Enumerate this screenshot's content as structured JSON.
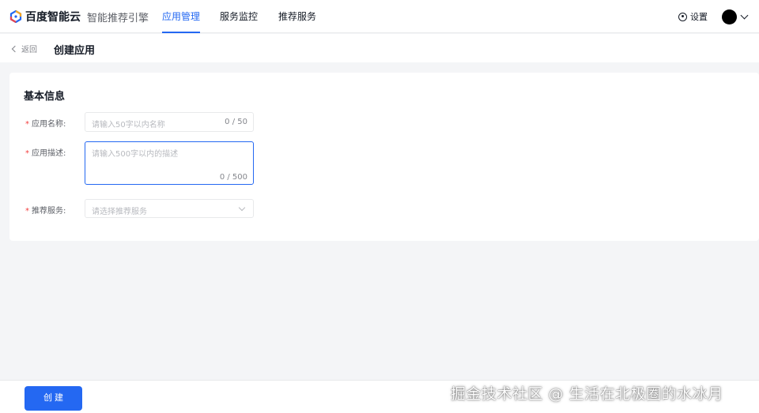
{
  "brand": {
    "name": "百度智能云",
    "product": "智能推荐引擎"
  },
  "nav": {
    "tabs": [
      {
        "label": "应用管理",
        "active": true
      },
      {
        "label": "服务监控",
        "active": false
      },
      {
        "label": "推荐服务",
        "active": false
      }
    ],
    "settings_label": "设置",
    "settings_icon": "gear-icon",
    "avatar_icon": "user-avatar"
  },
  "page": {
    "back_label": "返回",
    "title": "创建应用"
  },
  "form": {
    "section_title": "基本信息",
    "required_mark": "*",
    "name": {
      "label": "应用名称:",
      "placeholder": "请输入50字以内名称",
      "counter": "0 / 50"
    },
    "description": {
      "label": "应用描述:",
      "placeholder": "请输入500字以内的描述",
      "counter": "0 / 500"
    },
    "service": {
      "label": "推荐服务:",
      "placeholder": "请选择推荐服务"
    }
  },
  "footer": {
    "create_label": "创 建"
  },
  "watermark": "掘金技术社区 @ 生活在北极圈的水冰月",
  "colors": {
    "accent": "#2468f2",
    "required": "#f33e3e",
    "page_bg": "#f4f5f7"
  }
}
